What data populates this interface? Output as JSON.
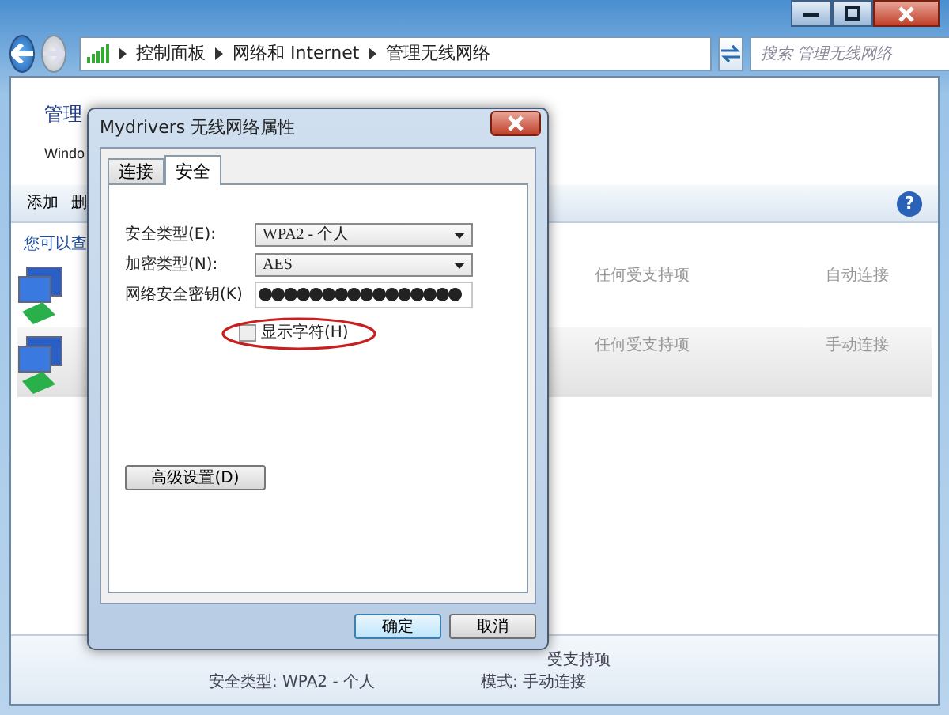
{
  "explorer": {
    "breadcrumb": [
      "控制面板",
      "网络和 Internet",
      "管理无线网络"
    ],
    "search": {
      "placeholder": "搜索 管理无线网络"
    },
    "heading": "管理",
    "subtitle": "Windo",
    "toolbar": [
      "添加",
      "删"
    ],
    "help": "?",
    "list_caption": "您可以查",
    "networks": [
      {
        "col_2": "任何受支持项",
        "col_3": "自动连接",
        "selected": false
      },
      {
        "col_2": "任何受支持项",
        "col_3": "手动连接",
        "selected": true
      }
    ],
    "details": {
      "line_1": "受支持项",
      "line_2": "安全类型: WPA2 - 个人",
      "line_3": "模式: 手动连接"
    }
  },
  "dialog": {
    "title": "Mydrivers 无线网络属性",
    "tabs": [
      {
        "label": "连接",
        "selected": false
      },
      {
        "label": "安全",
        "selected": true
      }
    ],
    "fields": [
      {
        "kind": "select",
        "label": "安全类型(E):",
        "value": "WPA2 - 个人"
      },
      {
        "kind": "select",
        "label": "加密类型(N):",
        "value": "AES"
      },
      {
        "kind": "password",
        "label": "网络安全密钥(K)",
        "value": "●●●●●●●●●●●●●●●●"
      }
    ],
    "show_characters": {
      "label": "显示字符(H)",
      "checked": false,
      "highlighted": true
    },
    "advanced_button": "高级设置(D)",
    "buttons": [
      "确定",
      "取消"
    ]
  }
}
